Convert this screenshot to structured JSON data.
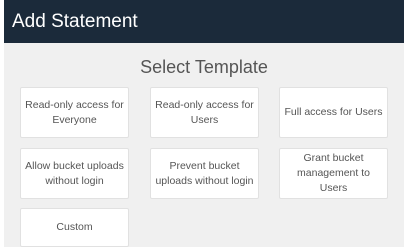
{
  "dialog": {
    "title": "Add Statement",
    "subtitle": "Select Template",
    "templates": [
      {
        "label": "Read-only access for Everyone"
      },
      {
        "label": "Read-only access for Users"
      },
      {
        "label": "Full access for Users"
      },
      {
        "label": "Allow bucket uploads without login"
      },
      {
        "label": "Prevent bucket uploads without login"
      },
      {
        "label": "Grant bucket management to Users"
      },
      {
        "label": "Custom"
      }
    ]
  },
  "colors": {
    "header_bg": "#1b2a3a",
    "dialog_bg": "#f0f0f0",
    "card_bg": "#ffffff",
    "text": "#555555"
  }
}
